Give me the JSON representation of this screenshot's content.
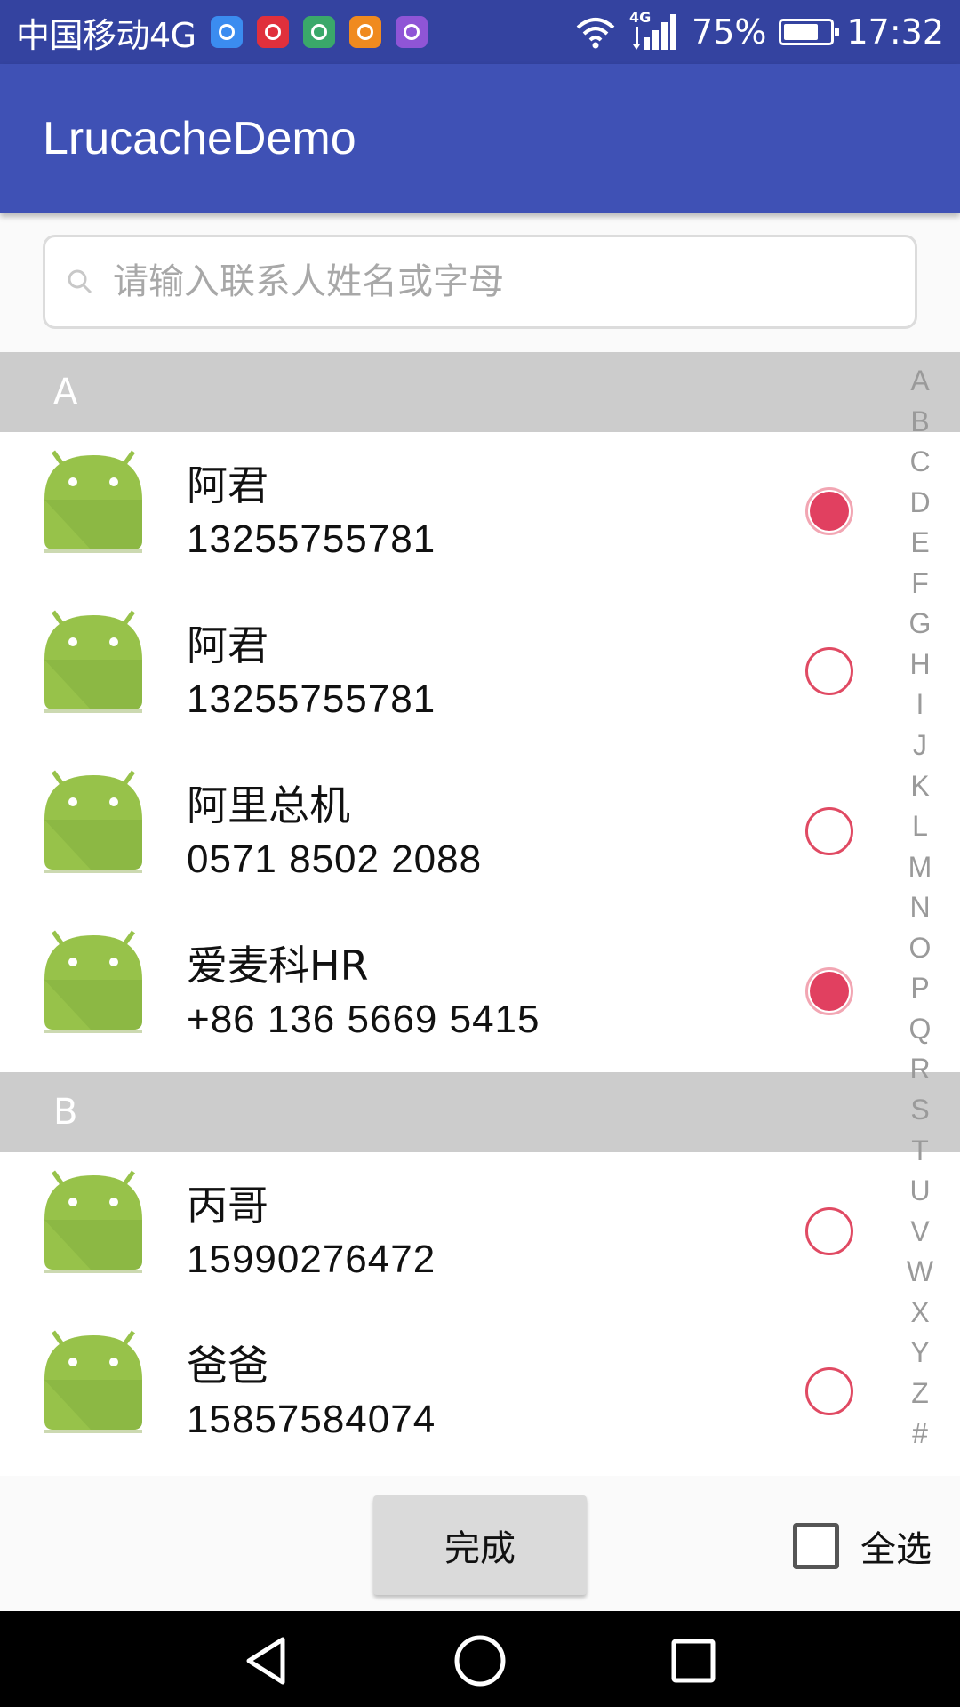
{
  "status_bar": {
    "carrier": "中国移动4G",
    "network": "4G",
    "battery": "75%",
    "battery_level": 0.75,
    "time": "17:32",
    "notification_icons": [
      {
        "name": "browser-icon",
        "color": "#3b8cf0"
      },
      {
        "name": "netease-music-icon",
        "color": "#e0303c"
      },
      {
        "name": "shopping-bag-icon",
        "color": "#3aa86a"
      },
      {
        "name": "orange-app-icon",
        "color": "#f08a1f"
      },
      {
        "name": "gallery-icon",
        "color": "#8f55d6"
      }
    ]
  },
  "app_bar": {
    "title": "LrucacheDemo"
  },
  "search": {
    "placeholder": "请输入联系人姓名或字母"
  },
  "sections": [
    {
      "letter": "A",
      "contacts": [
        {
          "name": "阿君",
          "phone": "13255755781",
          "checked": true
        },
        {
          "name": "阿君",
          "phone": "13255755781",
          "checked": false
        },
        {
          "name": "阿里总机",
          "phone": "0571 8502 2088",
          "checked": false
        },
        {
          "name": "爱麦科HR",
          "phone": "+86 136 5669 5415",
          "checked": true
        }
      ]
    },
    {
      "letter": "B",
      "contacts": [
        {
          "name": "丙哥",
          "phone": "15990276472",
          "checked": false
        },
        {
          "name": "爸爸",
          "phone": "15857584074",
          "checked": false
        }
      ]
    }
  ],
  "index_letters": [
    "A",
    "B",
    "C",
    "D",
    "E",
    "F",
    "G",
    "H",
    "I",
    "J",
    "K",
    "L",
    "M",
    "N",
    "O",
    "P",
    "Q",
    "R",
    "S",
    "T",
    "U",
    "V",
    "W",
    "X",
    "Y",
    "Z",
    "#"
  ],
  "actions": {
    "done_label": "完成",
    "select_all_label": "全选",
    "select_all_checked": false
  },
  "colors": {
    "status_bar": "#3443a0",
    "app_bar": "#3f51b5",
    "accent": "#e14060",
    "section_header": "#cccccc",
    "android_green": "#97c24a"
  }
}
